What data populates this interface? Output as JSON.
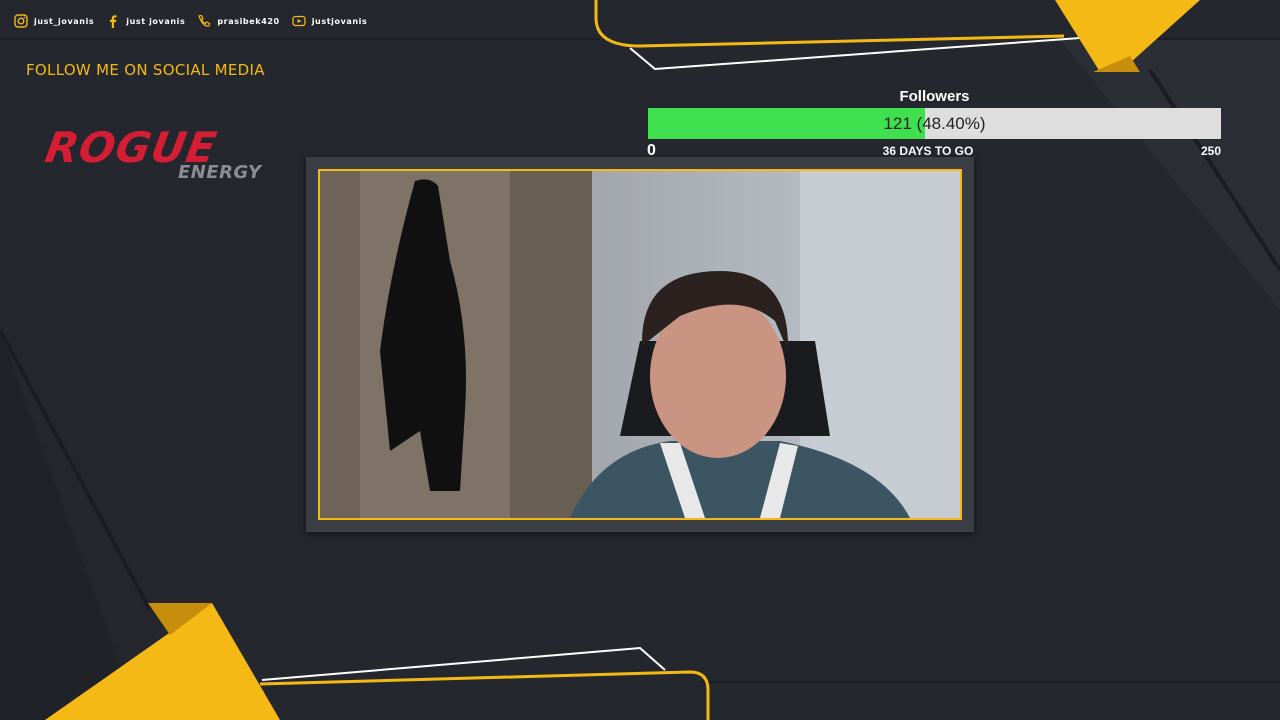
{
  "social": {
    "items": [
      {
        "icon": "instagram-icon",
        "label": "just_jovanis"
      },
      {
        "icon": "facebook-icon",
        "label": "just jovanis"
      },
      {
        "icon": "phone-icon",
        "label": "prasibek420"
      },
      {
        "icon": "youtube-icon",
        "label": "justjovanis"
      }
    ],
    "follow_title": "FOLLOW ME ON SOCIAL MEDIA"
  },
  "sponsor": {
    "brand": "ROGUE",
    "sub": "ENERGY"
  },
  "goal": {
    "title": "Followers",
    "current": 121,
    "target": 250,
    "progress_text": "121 (48.40%)",
    "progress_fraction": 0.484,
    "min_label": "0",
    "max_label": "250",
    "days_label": "36 DAYS TO GO",
    "fill_color": "#3fe04d",
    "track_color": "#dedede"
  },
  "colors": {
    "accent": "#f5b915",
    "background": "#24272d",
    "brand_red": "#d51e34"
  }
}
